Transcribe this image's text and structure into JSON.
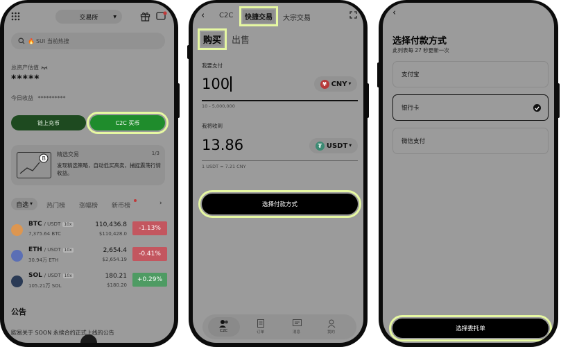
{
  "screen1": {
    "exchange_selector": "交易所",
    "search_placeholder": "SUI 当前热搜",
    "total_assets_label": "总资产估值",
    "total_assets_value": "*****",
    "today_pnl_label": "今日收益",
    "today_pnl_value": "**********",
    "onchain_button": "链上充币",
    "c2c_button": "C2C 买币",
    "featured": {
      "title": "精选交易",
      "page": "1/3",
      "desc": "发现精选策略，自动低买高卖，捕捉震荡行情收益。"
    },
    "market_tabs": [
      "自选",
      "热门榜",
      "涨幅榜",
      "新币榜"
    ],
    "coins": [
      {
        "symbol": "BTC",
        "quote": "/ USDT",
        "lev": "10x",
        "sub": "7,375.64 BTC",
        "price": "110,436.8",
        "price_fiat": "$110,428.0",
        "change": "-1.13%",
        "color": "#dd9650",
        "change_color": "#c3565f"
      },
      {
        "symbol": "ETH",
        "quote": "/ USDT",
        "lev": "10x",
        "sub": "30.94万 ETH",
        "price": "2,654.4",
        "price_fiat": "$2,654.19",
        "change": "-0.41%",
        "color": "#5b6fb5",
        "change_color": "#c3565f"
      },
      {
        "symbol": "SOL",
        "quote": "/ USDT",
        "lev": "10x",
        "sub": "105.21万 SOL",
        "price": "180.21",
        "price_fiat": "$180.20",
        "change": "+0.29%",
        "color": "#2a3a55",
        "change_color": "#4e9b63"
      }
    ],
    "announcement_title": "公告",
    "announcement_text": "欧易关于 SOON 永续合约正式上线的公告"
  },
  "screen2": {
    "top_tabs": [
      "C2C",
      "快捷交易",
      "大宗交易"
    ],
    "buy_tab": "购买",
    "sell_tab": "出售",
    "pay_label": "我要支付",
    "pay_amount": "100",
    "pay_currency": "CNY",
    "pay_currency_symbol": "¥",
    "pay_range": "10 - 5,000,000",
    "receive_label": "我将收到",
    "receive_amount": "13.86",
    "receive_currency": "USDT",
    "receive_currency_symbol": "₮",
    "rate": "1 USDT ≈ 7.21 CNY",
    "select_payment_button": "选择付款方式",
    "bottom_nav": [
      "C2C",
      "订单",
      "消息",
      "我的"
    ]
  },
  "screen3": {
    "title": "选择付款方式",
    "subtitle": "此列表每 27 秒更新一次",
    "methods": [
      "支付宝",
      "银行卡",
      "微信支付"
    ],
    "selected_method": "银行卡",
    "select_order_button": "选择委托单"
  },
  "colors": {
    "dim_bg": "#9b9b9b",
    "highlight": "#e6f8a2",
    "accent_green": "#1f8c2c",
    "button_black": "#000000"
  }
}
